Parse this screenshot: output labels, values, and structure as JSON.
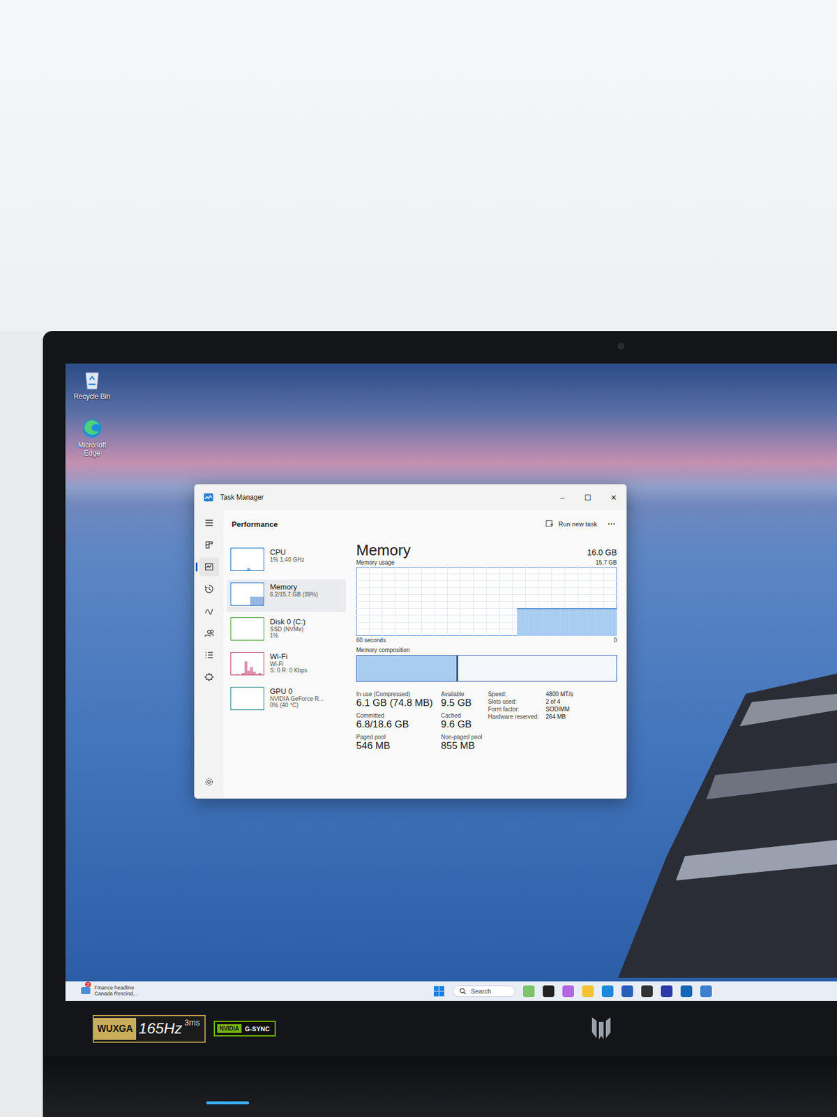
{
  "desktop": {
    "icons": [
      {
        "label": "Recycle Bin"
      },
      {
        "label": "Microsoft Edge"
      }
    ]
  },
  "window": {
    "title": "Task Manager",
    "controls": [
      "–",
      "☐",
      "✕"
    ]
  },
  "nav": [
    {
      "selected": false
    },
    {
      "selected": false
    },
    {
      "selected": true
    },
    {
      "selected": false
    },
    {
      "selected": false
    },
    {
      "selected": false
    },
    {
      "selected": false
    },
    {
      "selected": false
    }
  ],
  "header": {
    "title": "Performance",
    "run_task": "Run new task",
    "more": "···"
  },
  "resources": [
    {
      "name": "CPU",
      "lines": [
        "1% 1.40 GHz"
      ],
      "selected": false,
      "color": "#1f6fc0",
      "graph": [
        0,
        0,
        0,
        0,
        0,
        0.04,
        0.12,
        0.03,
        0,
        0,
        0.02,
        0
      ]
    },
    {
      "name": "Memory",
      "lines": [
        "6.2/15.7 GB (39%)"
      ],
      "selected": true,
      "color": "#3a78c9",
      "graph": [
        0,
        0,
        0,
        0,
        0,
        0,
        0,
        0.39,
        0.39,
        0.39,
        0.39,
        0.39
      ]
    },
    {
      "name": "Disk 0 (C:)",
      "lines": [
        "SSD (NVMe)",
        "1%"
      ],
      "selected": false,
      "color": "#4a9a2a",
      "graph": [
        0,
        0,
        0,
        0,
        0,
        0.02,
        0,
        0,
        0.03,
        0,
        0,
        0.01
      ]
    },
    {
      "name": "Wi-Fi",
      "lines": [
        "Wi-Fi",
        "S: 0 R: 0 Kbps"
      ],
      "selected": false,
      "color": "#c0396b",
      "graph": [
        0,
        0,
        0.05,
        0,
        0.1,
        0.6,
        0.2,
        0.35,
        0.15,
        0.05,
        0.1,
        0.02
      ]
    },
    {
      "name": "GPU 0",
      "lines": [
        "NVIDIA GeForce R...",
        "0% (40 °C)"
      ],
      "selected": false,
      "color": "#1a7f8a",
      "graph": [
        0,
        0,
        0,
        0,
        0,
        0,
        0,
        0,
        0,
        0,
        0,
        0
      ]
    }
  ],
  "detail": {
    "title": "Memory",
    "total": "16.0 GB",
    "usage_label": "Memory usage",
    "usage_max": "15.7 GB",
    "axis_left": "60 seconds",
    "axis_right": "0",
    "composition_label": "Memory composition",
    "chart": {
      "max": 15.7,
      "values": [
        0,
        0,
        0,
        0,
        0,
        0,
        0,
        0,
        0,
        0,
        0,
        0,
        0,
        0,
        0,
        0,
        0,
        0,
        0,
        0,
        0,
        0,
        0,
        0,
        0,
        0,
        0,
        0,
        0,
        0,
        0,
        0,
        0,
        0,
        0,
        0,
        0,
        6.2,
        6.2,
        6.2,
        6.2,
        6.2,
        6.2,
        6.2,
        6.2,
        6.2,
        6.2,
        6.2,
        6.2,
        6.2,
        6.2,
        6.2,
        6.2,
        6.2,
        6.2,
        6.2,
        6.2,
        6.2,
        6.2,
        6.2
      ]
    },
    "composition": [
      {
        "level": 0.385,
        "color": "#a9cdf1"
      },
      {
        "level": 0.006,
        "color": "#2b4f8a"
      },
      {
        "level": 0.609,
        "color": "#f4f8fd"
      }
    ],
    "stats": [
      {
        "label": "In use (Compressed)",
        "value": "6.1 GB (74.8 MB)"
      },
      {
        "label": "Available",
        "value": "9.5 GB"
      },
      {
        "label": "Committed",
        "value": "6.8/18.6 GB"
      },
      {
        "label": "Cached",
        "value": "9.6 GB"
      },
      {
        "label": "Paged pool",
        "value": "546 MB"
      },
      {
        "label": "Non-paged pool",
        "value": "855 MB"
      }
    ],
    "specs": [
      {
        "label": "Speed:",
        "value": "4800 MT/s"
      },
      {
        "label": "Slots used:",
        "value": "2 of 4"
      },
      {
        "label": "Form factor:",
        "value": "SODIMM"
      },
      {
        "label": "Hardware reserved:",
        "value": "264 MB"
      }
    ]
  },
  "taskbar": {
    "widget": {
      "badge": "2",
      "lines": [
        "Finance headline",
        "Canada Rescind..."
      ]
    },
    "search": {
      "placeholder": "Search"
    },
    "apps": [
      {
        "color": "#7cc46a"
      },
      {
        "color": "#222222"
      },
      {
        "color": "#b466e0"
      },
      {
        "color": "#f2c230"
      },
      {
        "color": "#1b8ad8"
      },
      {
        "color": "#2a5fb8"
      },
      {
        "color": "#333333"
      },
      {
        "color": "#2b3aa8"
      },
      {
        "color": "#1466b8"
      },
      {
        "color": "#3d7fd0"
      }
    ]
  },
  "badges": {
    "panel": [
      "WUXGA",
      "165Hz",
      "3ms"
    ],
    "gpu": [
      "NVIDIA",
      "G-SYNC"
    ]
  }
}
